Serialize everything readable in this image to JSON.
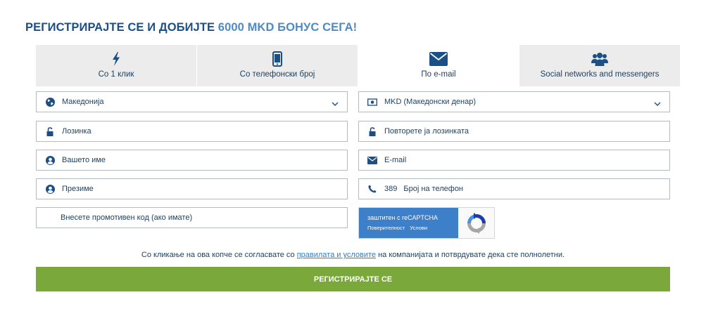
{
  "heading": {
    "main": "РЕГИСТРИРАЈТЕ СЕ И ДОБИЈТЕ",
    "accent": "6000 MKD БОНУС СЕГА!"
  },
  "tabs": [
    {
      "label": "Со 1 клик",
      "icon": "lightning-icon"
    },
    {
      "label": "Со телефонски број",
      "icon": "phone-icon"
    },
    {
      "label": "По e-mail",
      "icon": "envelope-icon",
      "active": true
    },
    {
      "label": "Social networks and messengers",
      "icon": "users-icon"
    }
  ],
  "form": {
    "country": {
      "value": "Македонија",
      "icon": "globe-icon"
    },
    "currency": {
      "value": "MKD (Македонски денар)",
      "icon": "banknote-icon"
    },
    "password": {
      "placeholder": "Лозинка",
      "icon": "lock-icon"
    },
    "password_repeat": {
      "placeholder": "Повторете ја лозинката",
      "icon": "lock-icon"
    },
    "first_name": {
      "placeholder": "Вашето име",
      "icon": "user-icon"
    },
    "email": {
      "placeholder": "E-mail",
      "icon": "envelope-icon"
    },
    "last_name": {
      "placeholder": "Презиме",
      "icon": "user-icon"
    },
    "phone": {
      "prefix": "389",
      "placeholder": "Број на телефон",
      "icon": "phone-handset-icon"
    },
    "promo": {
      "placeholder": "Внесете промотивен код (ако имате)"
    }
  },
  "captcha": {
    "title": "заштитен с reCAPTCHA",
    "privacy": "Поверителност",
    "terms": "Услови"
  },
  "terms": {
    "before": "Со кликање на ова копче се согласвате со ",
    "link": "правилата и условите",
    "after": " на компанијата и потврдувате дека сте полнолетни."
  },
  "submit_label": "РЕГИСТРИРАЈТЕ СЕ",
  "colors": {
    "heading": "#1b4f86",
    "accent": "#4f8bc2",
    "button": "#7aa83a",
    "tab_bg": "#ececec",
    "icon": "#1b4f86"
  }
}
